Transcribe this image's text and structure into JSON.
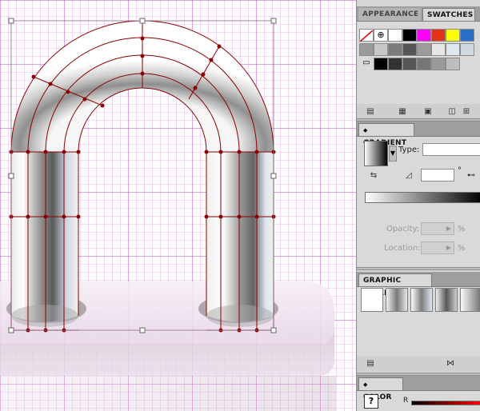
{
  "artboard": {
    "name": "pipe-arch-gradient-mesh"
  },
  "panels": {
    "top_group": {
      "tabs": [
        {
          "label": "APPEARANCE",
          "active": false
        },
        {
          "label": "SWATCHES",
          "active": true
        }
      ],
      "swatch_colors": [
        "#ffffff",
        "#000000",
        "#ff00ff",
        "#e3321b",
        "#ffff00",
        "#2a6fc7",
        "#9a9a9a",
        "#c8c8c8",
        "#7b7b7b",
        "#e6e6e6",
        "#dde8ee",
        "#cfd8df",
        "#000000",
        "#333333",
        "#555555",
        "#777777",
        "#9a9a9a",
        "#bdbdbd"
      ]
    },
    "gradient": {
      "tab_label": "GRADIENT",
      "type_label": "Type:",
      "type_value": "",
      "angle_value": "",
      "degree_symbol": "°",
      "opacity_label": "Opacity:",
      "opacity_value": "",
      "location_label": "Location:",
      "location_value": "",
      "percent": "%"
    },
    "graphic_styles": {
      "tab_label": "GRAPHIC STYLES"
    },
    "color": {
      "tab_label": "COLOR",
      "r_label": "R",
      "question_mark": "?"
    }
  }
}
